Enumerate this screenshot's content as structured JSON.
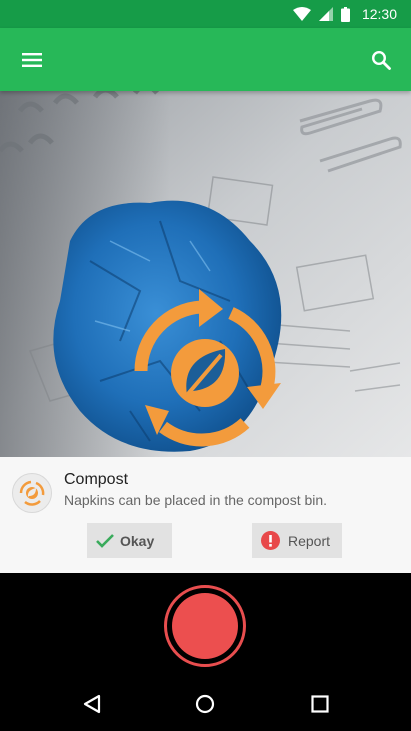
{
  "status_bar": {
    "time": "12:30",
    "icons": [
      "wifi-icon",
      "signal-icon",
      "battery-icon"
    ]
  },
  "toolbar": {
    "menu_icon": "hamburger-menu-icon",
    "search_icon": "search-icon",
    "color": "#27b858"
  },
  "hero": {
    "overlay_icon": "compost-recycle-leaf-icon",
    "accent": "#f39b3c"
  },
  "result_card": {
    "icon": "compost-icon",
    "title": "Compost",
    "description": "Napkins can be placed in the compost bin.",
    "okay_label": "Okay",
    "okay_icon": "check-icon",
    "report_label": "Report",
    "report_icon": "alert-icon",
    "report_color": "#e8484a"
  },
  "camera": {
    "record_icon": "record-button",
    "record_color": "#ec4f4f"
  },
  "nav": {
    "back_icon": "back-triangle-icon",
    "home_icon": "home-circle-icon",
    "recents_icon": "recents-square-icon"
  }
}
